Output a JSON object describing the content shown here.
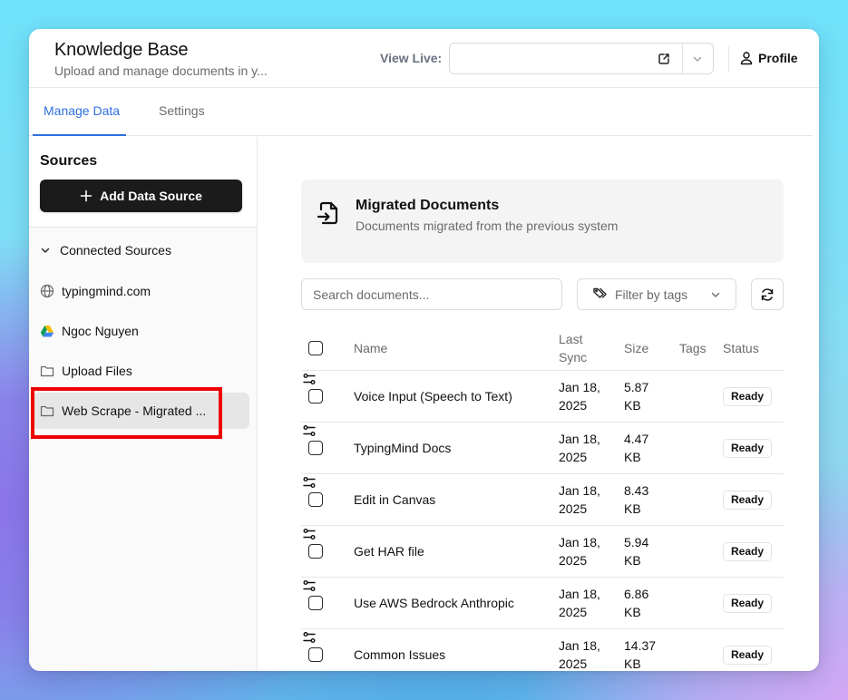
{
  "header": {
    "title": "Knowledge Base",
    "subtitle": "Upload and manage documents in y...",
    "view_live_label": "View Live:",
    "view_live_value": "",
    "profile_label": "Profile"
  },
  "tabs": [
    {
      "label": "Manage Data",
      "active": true
    },
    {
      "label": "Settings",
      "active": false
    }
  ],
  "sidebar": {
    "heading": "Sources",
    "add_button_label": "Add Data Source",
    "connected_label": "Connected Sources",
    "items": [
      {
        "label": "typingmind.com",
        "icon": "globe-icon"
      },
      {
        "label": "Ngoc Nguyen",
        "icon": "google-drive-icon"
      },
      {
        "label": "Upload Files",
        "icon": "folder-icon"
      },
      {
        "label": "Web Scrape - Migrated ...",
        "icon": "folder-icon",
        "active": true
      }
    ]
  },
  "main": {
    "card": {
      "title": "Migrated Documents",
      "description": "Documents migrated from the previous system",
      "icon": "file-import-icon"
    },
    "search_placeholder": "Search documents...",
    "filter_label": "Filter by tags",
    "table": {
      "headers": {
        "name": "Name",
        "last_sync": "Last Sync",
        "size": "Size",
        "tags": "Tags",
        "status": "Status"
      },
      "rows": [
        {
          "name": "Voice Input (Speech to Text)",
          "last_sync": "Jan 18, 2025",
          "size": "5.87 KB",
          "status": "Ready"
        },
        {
          "name": "TypingMind Docs",
          "last_sync": "Jan 18, 2025",
          "size": "4.47 KB",
          "status": "Ready"
        },
        {
          "name": "Edit in Canvas",
          "last_sync": "Jan 18, 2025",
          "size": "8.43 KB",
          "status": "Ready"
        },
        {
          "name": "Get HAR file",
          "last_sync": "Jan 18, 2025",
          "size": "5.94 KB",
          "status": "Ready"
        },
        {
          "name": "Use AWS Bedrock Anthropic",
          "last_sync": "Jan 18, 2025",
          "size": "6.86 KB",
          "status": "Ready"
        },
        {
          "name": "Common Issues",
          "last_sync": "Jan 18, 2025",
          "size": "14.37 KB",
          "status": "Ready"
        }
      ]
    }
  },
  "colors": {
    "accent": "#2f6fe0",
    "primary_button": "#1b1b1b",
    "highlight": "#ee0000"
  }
}
